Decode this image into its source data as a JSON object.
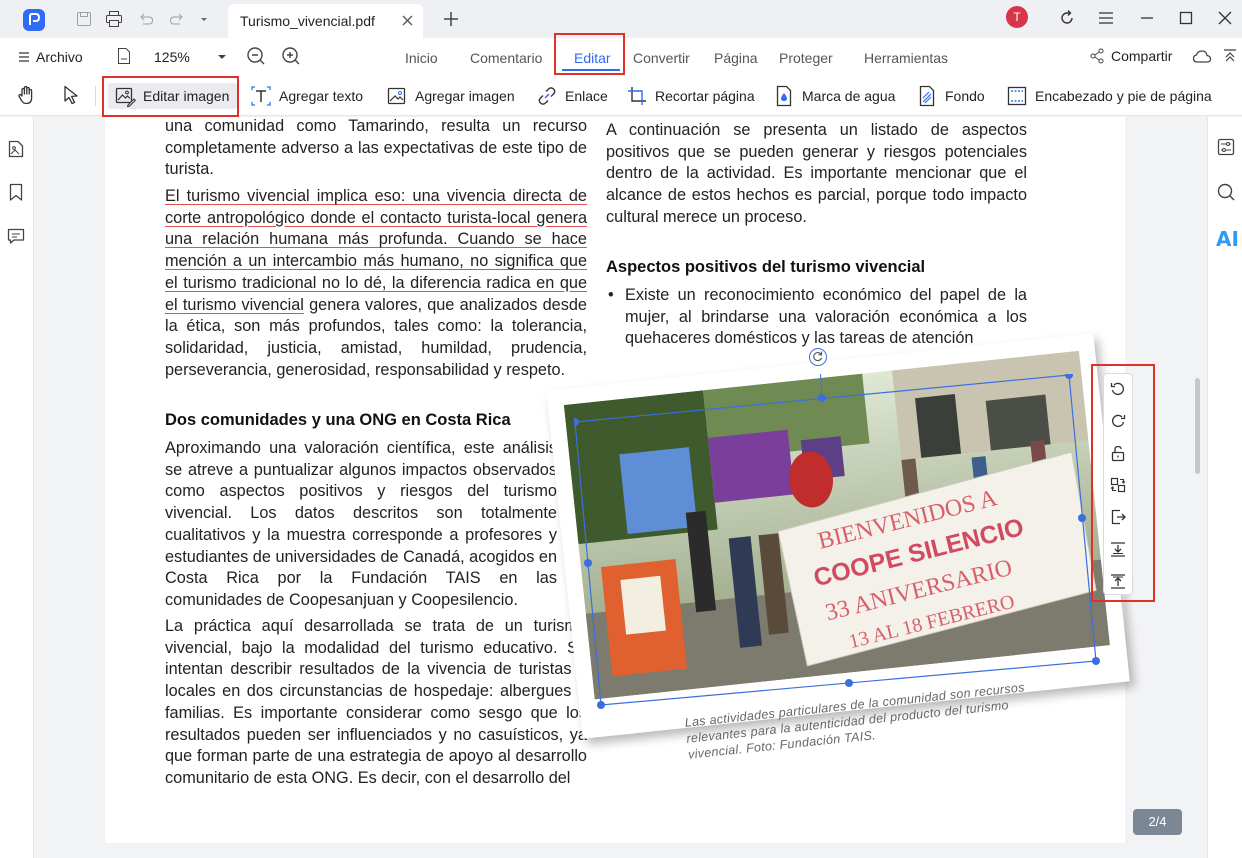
{
  "titlebar": {
    "tab_title": "Turismo_vivencial.pdf",
    "avatar_initial": "T"
  },
  "menubar": {
    "file_label": "Archivo",
    "zoom_value": "125%",
    "tabs": [
      "Inicio",
      "Comentario",
      "Editar",
      "Convertir",
      "Página",
      "Proteger",
      "Herramientas"
    ],
    "active_tab": "Editar",
    "share_label": "Compartir"
  },
  "toolbar": {
    "edit_image": "Editar imagen",
    "add_text": "Agregar texto",
    "add_image": "Agregar imagen",
    "link": "Enlace",
    "crop_page": "Recortar página",
    "watermark": "Marca de agua",
    "background": "Fondo",
    "header_footer": "Encabezado y pie de página"
  },
  "document": {
    "left_p1": "una comunidad como Tamarindo, resulta un recurso completamente adverso a las expectativas de este tipo de turista.",
    "left_p2_underlined": "El turismo vivencial implica eso: una vivencia directa de corte antropológico donde el contacto turista-local genera una relación humana más profunda. Cuando se hace mención a un intercambio más humano, no significa que el turismo tradicional no lo dé, la diferencia radica en que el turismo vivencial",
    "left_p2_rest": " genera valores, que analizados desde la ética, son más profundos, tales como: la tolerancia, solidaridad, justicia, amistad, humildad, prudencia, perseverancia, generosidad, responsabilidad y respeto.",
    "heading_left": "Dos comunidades y una ONG en Costa Rica",
    "left_p3": "Aproximando una valoración científica, este análisis se atreve a puntualizar algunos impactos observados como aspectos positivos y riesgos del turismo vivencial. Los datos descritos son totalmente cualitativos y la muestra corresponde a profesores y estudiantes de universidades de Canadá, acogidos en Costa Rica por la Fundación TAIS en las comunidades de Coopesanjuan y Coopesilencio.",
    "left_p4": "La práctica aquí desarrollada se trata de un turismo vivencial, bajo la modalidad del turismo educativo. Se intentan describir resultados de la vivencia de turistas y locales en dos circunstancias de hospedaje: albergues o familias. Es importante considerar como sesgo que los resultados pueden ser influenciados y no casuísticos, ya que forman parte de una estrategia de apoyo al desarrollo comunitario de esta ONG. Es decir, con el desarrollo del",
    "right_p1": "A continuación se presenta un listado de aspectos positivos que se pueden generar y riesgos potenciales dentro de la actividad. Es importante mencionar que el alcance de estos hechos es parcial, porque todo impacto cultural merece un proceso.",
    "heading_right": "Aspectos positivos del turismo vivencial",
    "bullet_mark": "•",
    "bullet1": "Existe un reconocimiento económico del papel de la mujer, al brindarse una valoración económica a los quehaceres domésticos y las tareas de atención",
    "banner_line1": "BIENVENIDOS A",
    "banner_line2": "COOPE SILENCIO",
    "banner_line3": "33  ANIVERSARIO",
    "banner_line4": "13   AL  18  FEBRERO",
    "caption": "Las actividades particulares de la comunidad son recursos relevantes para la autenticidad del producto del turismo vivencial. Foto: Fundación TAIS."
  },
  "page_indicator": "2/4",
  "colors": {
    "accent": "#2f6bf5",
    "highlight_red": "#e0302a",
    "underline_red": "#e05050"
  }
}
